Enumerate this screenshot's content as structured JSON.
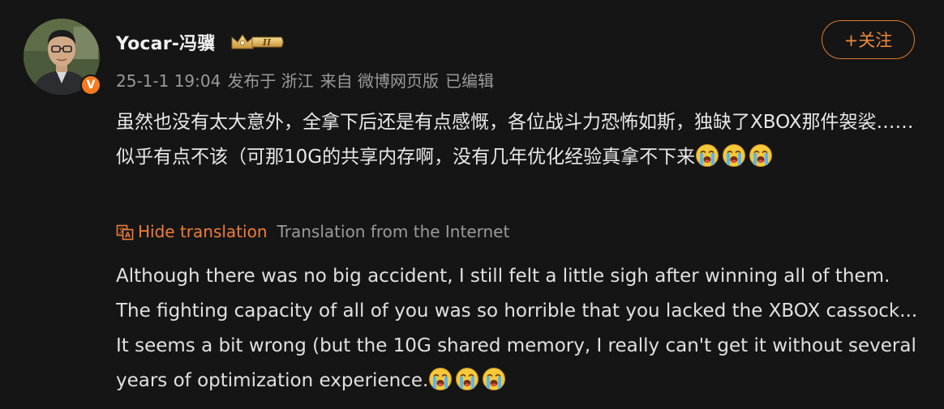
{
  "post": {
    "username": "Yocar-冯骥",
    "rank_badge": "II",
    "verified_mark": "V",
    "meta": {
      "date": "25-1-1 19:04",
      "published_at": "发布于 浙江",
      "source": "来自 微博网页版",
      "edited": "已编辑"
    },
    "follow_button": "+关注",
    "content_cn": "虽然也没有太大意外，全拿下后还是有点感慨，各位战斗力恐怖如斯，独缺了XBOX那件袈裟……似乎有点不该（可那10G的共享内存啊，没有几年优化经验真拿不下来",
    "translation": {
      "hide_label": "Hide translation",
      "source_label": "Translation from the Internet",
      "icon": "translate-icon"
    },
    "content_en": "Although there was no big accident, I still felt a little sigh after winning all of them. The fighting capacity of all of you was so horrible that you lacked the XBOX cassock... It seems a bit wrong (but the 10G shared memory, I really can't get it without several years of optimization experience.",
    "emoji": "crying-face-emoji",
    "colors": {
      "background": "#151515",
      "accent": "#ef7d37",
      "meta_text": "#9a9a9a"
    }
  }
}
